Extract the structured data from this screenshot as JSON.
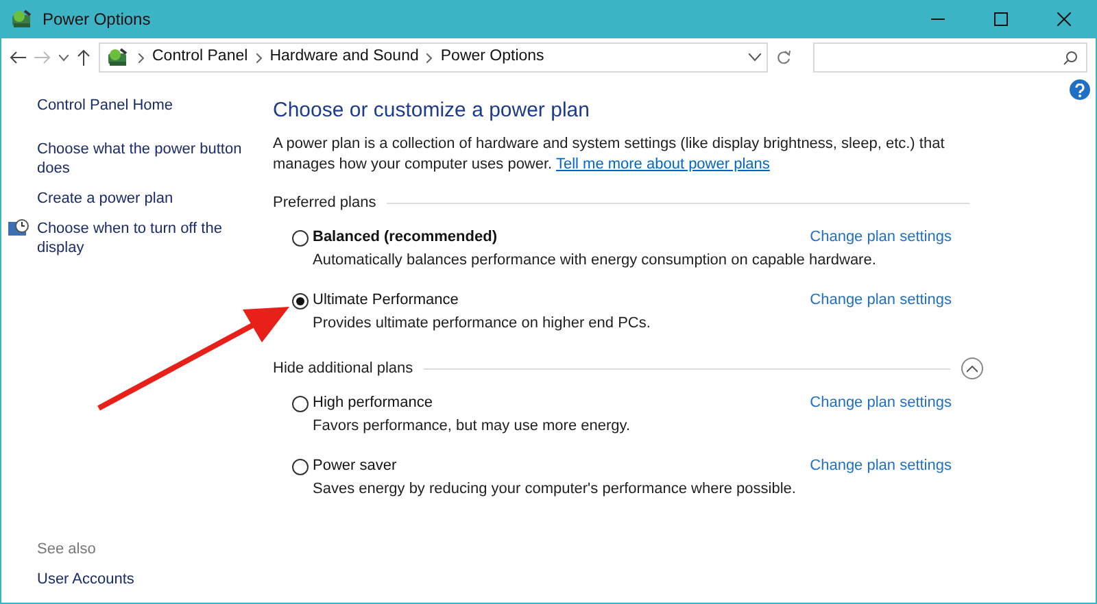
{
  "window": {
    "title": "Power Options"
  },
  "address_bar": {
    "breadcrumbs": [
      "Control Panel",
      "Hardware and Sound",
      "Power Options"
    ]
  },
  "sidebar": {
    "links": [
      {
        "label": "Control Panel Home",
        "kind": "plain"
      },
      {
        "label": "Choose what the power button does",
        "kind": "plain"
      },
      {
        "label": "Create a power plan",
        "kind": "plain"
      },
      {
        "label": "Choose when to turn off the display",
        "kind": "icon"
      }
    ],
    "see_also": {
      "label": "See also",
      "links": [
        "User Accounts"
      ]
    }
  },
  "main": {
    "heading": "Choose or customize a power plan",
    "description": "A power plan is a collection of hardware and system settings (like display brightness, sleep, etc.) that manages how your computer uses power.",
    "description_link": "Tell me more about power plans",
    "groups": [
      {
        "label": "Preferred plans",
        "kind": "fixed",
        "plans": [
          {
            "name": "Balanced (recommended)",
            "emphasized": true,
            "selected": false,
            "description": "Automatically balances performance with energy consumption on capable hardware.",
            "link": "Change plan settings"
          },
          {
            "name": "Ultimate Performance",
            "emphasized": false,
            "selected": true,
            "description": "Provides ultimate performance on higher end PCs.",
            "link": "Change plan settings"
          }
        ]
      },
      {
        "label": "Hide additional plans",
        "kind": "collapsible",
        "expanded": true,
        "plans": [
          {
            "name": "High performance",
            "emphasized": false,
            "selected": false,
            "description": "Favors performance, but may use more energy.",
            "link": "Change plan settings"
          },
          {
            "name": "Power saver",
            "emphasized": false,
            "selected": false,
            "description": "Saves energy by reducing your computer's performance where possible.",
            "link": "Change plan settings"
          }
        ]
      }
    ]
  },
  "annotation": {
    "kind": "arrow"
  }
}
